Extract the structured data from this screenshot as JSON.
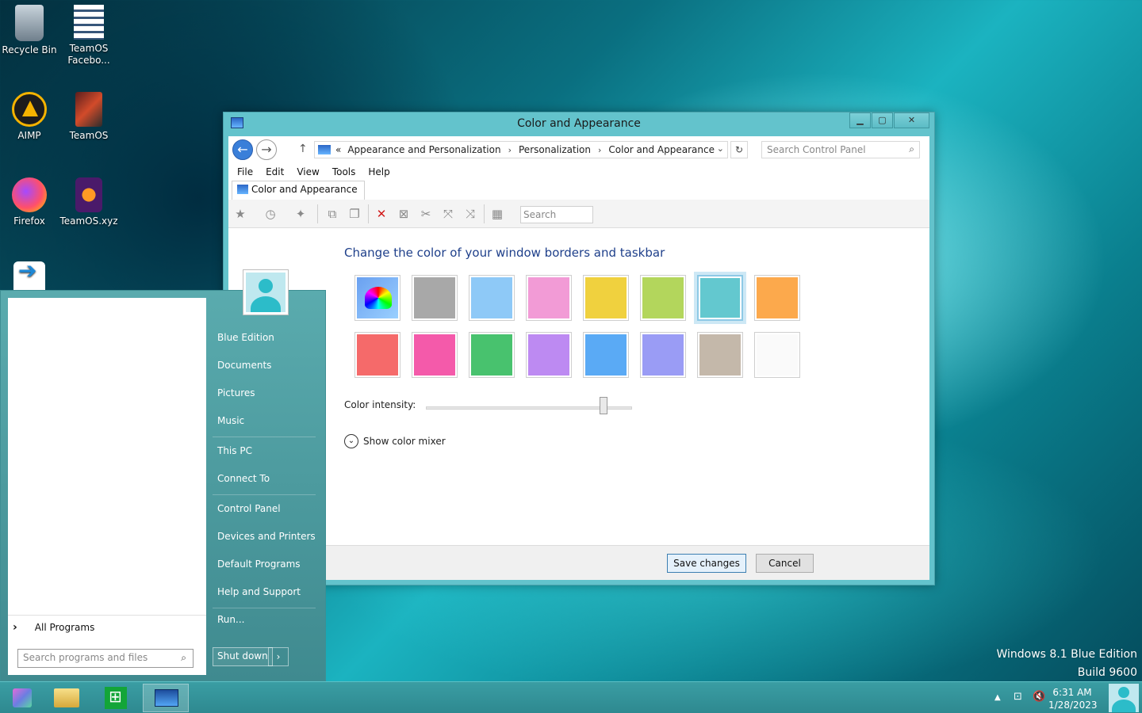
{
  "desktop": {
    "icons": [
      {
        "label": "Recycle Bin",
        "icon": "recycle-bin-icon"
      },
      {
        "label": "TeamOS Facebo...",
        "icon": "document-list-icon"
      },
      {
        "label": "AIMP",
        "icon": "aimp-icon"
      },
      {
        "label": "TeamOS",
        "icon": "teamos-icon"
      },
      {
        "label": "Firefox",
        "icon": "firefox-icon"
      },
      {
        "label": "TeamOS.xyz",
        "icon": "firefox-shortcut-icon"
      }
    ]
  },
  "window": {
    "title": "Color and Appearance",
    "breadcrumb": [
      "Appearance and Personalization",
      "Personalization",
      "Color and Appearance"
    ],
    "breadcrumb_prefix": "«",
    "search_placeholder": "Search Control Panel",
    "menu": [
      "File",
      "Edit",
      "View",
      "Tools",
      "Help"
    ],
    "tab_label": "Color and Appearance",
    "toolbar_search_placeholder": "Search",
    "heading": "Change the color of your window borders and taskbar",
    "swatches": [
      {
        "color": "palette",
        "selected": false
      },
      {
        "color": "#a8a8a8",
        "selected": false
      },
      {
        "color": "#8ec9f7",
        "selected": false
      },
      {
        "color": "#f29bd6",
        "selected": false
      },
      {
        "color": "#f0d13e",
        "selected": false
      },
      {
        "color": "#b3d65c",
        "selected": false
      },
      {
        "color": "#63c8cf",
        "selected": true
      },
      {
        "color": "#fca94c",
        "selected": false
      },
      {
        "color": "#f56a6a",
        "selected": false
      },
      {
        "color": "#f45aaa",
        "selected": false
      },
      {
        "color": "#48c26e",
        "selected": false
      },
      {
        "color": "#bd8af2",
        "selected": false
      },
      {
        "color": "#5aaaf5",
        "selected": false
      },
      {
        "color": "#9a9cf5",
        "selected": false
      },
      {
        "color": "#c4b8aa",
        "selected": false
      },
      {
        "color": "#fafafa",
        "selected": false
      }
    ],
    "intensity_label": "Color intensity:",
    "intensity_value": 0.86,
    "mixer_label": "Show color mixer",
    "save_label": "Save changes",
    "cancel_label": "Cancel"
  },
  "start_menu": {
    "right_items": [
      "Blue Edition",
      "Documents",
      "Pictures",
      "Music",
      "This PC",
      "Connect To",
      "Control Panel",
      "Devices and Printers",
      "Default Programs",
      "Help and Support",
      "Run..."
    ],
    "all_programs": "All Programs",
    "search_placeholder": "Search programs and files",
    "shutdown_label": "Shut down"
  },
  "watermark": {
    "line1": "Windows 8.1 Blue Edition",
    "line2": "Build 9600"
  },
  "taskbar": {
    "time": "6:31 AM",
    "date": "1/28/2023"
  },
  "colors": {
    "window_frame": "#63c3cc",
    "heading": "#1e3f8a"
  }
}
